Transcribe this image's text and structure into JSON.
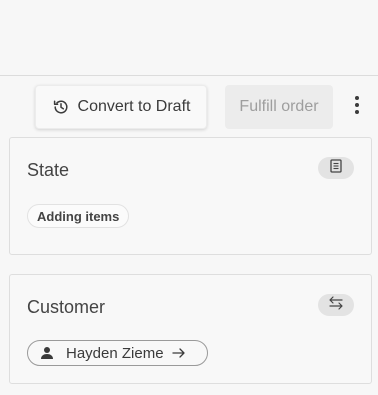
{
  "toolbar": {
    "convert_label": "Convert to Draft",
    "fulfill_label": "Fulfill order",
    "icons": {
      "convert": "history-icon",
      "more": "more-vertical-icon"
    }
  },
  "state_card": {
    "title": "State",
    "status": "Adding items",
    "icon": "document-icon"
  },
  "customer_card": {
    "title": "Customer",
    "customer_name": "Hayden Zieme",
    "icon": "swap-icon",
    "person_icon": "person-icon",
    "arrow_icon": "arrow-right-icon"
  },
  "colors": {
    "background": "#f7f7f7",
    "card_border": "#dedede",
    "disabled_text": "#9e9e9e"
  }
}
